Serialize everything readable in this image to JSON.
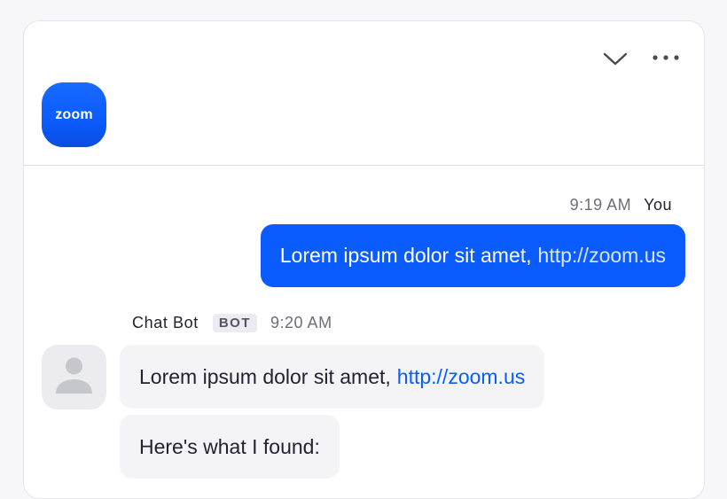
{
  "header": {
    "logo_text": "zoom",
    "collapse_icon": "chevron-down-icon",
    "more_icon": "more-horizontal-icon"
  },
  "messages": {
    "outgoing": {
      "time": "9:19 AM",
      "sender": "You",
      "text": "Lorem ipsum dolor sit amet,",
      "link": "http://zoom.us"
    },
    "incoming": {
      "sender": "Chat Bot",
      "badge": "BOT",
      "time": "9:20 AM",
      "avatar_icon": "user-icon",
      "bubbles": [
        {
          "text": "Lorem ipsum dolor sit amet,",
          "link": "http://zoom.us"
        },
        {
          "text": "Here's what I found:"
        }
      ]
    }
  },
  "colors": {
    "brand_blue": "#0b5cff",
    "bubble_gray": "#f4f4f7",
    "badge_gray": "#ebebf0"
  }
}
